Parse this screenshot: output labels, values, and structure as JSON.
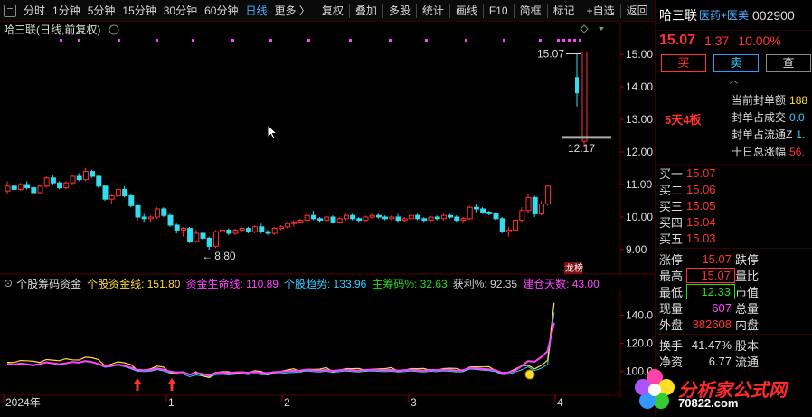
{
  "toolbar": {
    "left_items": [
      "分时",
      "1分钟",
      "5分钟",
      "15分钟",
      "30分钟",
      "60分钟",
      "日线",
      "更多 〉"
    ],
    "active_item": "日线",
    "right_items": [
      "复权",
      "叠加",
      "多股",
      "统计",
      "画线",
      "F10",
      "简框",
      "标记",
      "+自选",
      "返回"
    ]
  },
  "main_chart": {
    "title": "哈三联(日线,前复权)",
    "price_axis": [
      "15.00",
      "14.00",
      "13.00",
      "12.00",
      "11.00",
      "10.00",
      "9.00"
    ],
    "high_label": "15.07",
    "low_label": "12.17",
    "min_label": "8.80",
    "lhb_badge": "龙榜"
  },
  "indicator": {
    "name": "个股筹码资金",
    "lines": [
      {
        "label": "个股资金线: 151.80",
        "color": "#ffdd33"
      },
      {
        "label": "资金生命线: 110.89",
        "color": "#ff44ff"
      },
      {
        "label": "个股趋势: 133.96",
        "color": "#33ccff"
      },
      {
        "label": "主筹码%: 32.63",
        "color": "#22dd22"
      },
      {
        "label": "获利%: 92.35",
        "color": "#cccccc"
      },
      {
        "label": "建仓天数: 43.00",
        "color": "#ff44ff"
      }
    ],
    "axis": [
      "140.0",
      "120.0",
      "100.0"
    ]
  },
  "time_axis": {
    "labels": [
      "2024年",
      "1",
      "2",
      "3",
      "4"
    ]
  },
  "right_panel": {
    "name": "哈三联",
    "tags": "医药+医美",
    "code": "002900",
    "price": "15.07",
    "change": "1.37",
    "change_pct": "10.00%",
    "buttons": [
      "买",
      "卖",
      "查"
    ],
    "board_text": "5天4板",
    "seal": [
      {
        "label": "当前封单额",
        "value": "188"
      },
      {
        "label": "封单占成交",
        "value": "0.0"
      },
      {
        "label": "封单占流通Z",
        "value": "1."
      },
      {
        "label": "十日总涨幅",
        "value": "56."
      }
    ],
    "bids": [
      {
        "label": "买一",
        "value": "15.07"
      },
      {
        "label": "买二",
        "value": "15.06"
      },
      {
        "label": "买三",
        "value": "15.05"
      },
      {
        "label": "买四",
        "value": "15.04"
      },
      {
        "label": "买五",
        "value": "15.03"
      }
    ],
    "stats": [
      {
        "label": "涨停",
        "value": "15.07",
        "label2": "跌停"
      },
      {
        "label": "最高",
        "value": "15.07",
        "label2": "量比"
      },
      {
        "label": "最低",
        "value": "12.33",
        "label2": "市值"
      },
      {
        "label": "现量",
        "value": "607",
        "label2": "总量"
      },
      {
        "label": "外盘",
        "value": "382608",
        "label2": "内盘"
      }
    ],
    "stats2": [
      {
        "label": "换手",
        "value": "41.47%",
        "label2": "股本"
      },
      {
        "label": "净资",
        "value": "6.77",
        "label2": "流通"
      }
    ]
  },
  "watermark": {
    "text": "分析家公式网",
    "url": "70822.com"
  },
  "colors": {
    "up": "#ff3333",
    "down": "#33ddee",
    "bg": "#000000",
    "ma_yellow": "#ffdd33",
    "ma_magenta": "#ff44ff"
  },
  "chart_data": {
    "type": "candlestick",
    "ylim": [
      8.5,
      15.5
    ],
    "candles": [
      [
        10.8,
        11.1,
        10.7,
        10.95
      ],
      [
        10.95,
        11.0,
        10.8,
        10.85
      ],
      [
        10.85,
        11.05,
        10.8,
        11.0
      ],
      [
        11.0,
        11.1,
        10.85,
        10.9
      ],
      [
        10.9,
        10.95,
        10.7,
        10.75
      ],
      [
        10.75,
        11.0,
        10.7,
        10.95
      ],
      [
        10.95,
        11.25,
        10.9,
        11.2
      ],
      [
        11.2,
        11.3,
        11.0,
        11.05
      ],
      [
        11.05,
        11.1,
        10.85,
        10.9
      ],
      [
        10.9,
        11.1,
        10.85,
        11.05
      ],
      [
        11.05,
        11.3,
        11.0,
        11.25
      ],
      [
        11.25,
        11.35,
        11.1,
        11.15
      ],
      [
        11.15,
        11.5,
        11.1,
        11.4
      ],
      [
        11.4,
        11.45,
        11.2,
        11.25
      ],
      [
        11.25,
        11.3,
        10.9,
        10.95
      ],
      [
        10.95,
        11.0,
        10.5,
        10.55
      ],
      [
        10.55,
        10.7,
        10.4,
        10.65
      ],
      [
        10.65,
        10.9,
        10.6,
        10.85
      ],
      [
        10.85,
        10.95,
        10.6,
        10.65
      ],
      [
        10.65,
        10.7,
        10.3,
        10.35
      ],
      [
        10.35,
        10.4,
        9.9,
        10.0
      ],
      [
        10.0,
        10.1,
        9.85,
        9.95
      ],
      [
        9.95,
        10.05,
        9.85,
        10.0
      ],
      [
        10.0,
        10.3,
        9.95,
        10.25
      ],
      [
        10.25,
        10.3,
        10.0,
        10.05
      ],
      [
        10.05,
        10.1,
        9.7,
        9.75
      ],
      [
        9.75,
        9.8,
        9.5,
        9.6
      ],
      [
        9.6,
        9.7,
        9.4,
        9.65
      ],
      [
        9.65,
        9.7,
        9.2,
        9.25
      ],
      [
        9.25,
        9.6,
        9.2,
        9.5
      ],
      [
        9.5,
        9.55,
        9.3,
        9.35
      ],
      [
        9.35,
        9.4,
        9.0,
        9.1
      ],
      [
        9.1,
        9.6,
        9.05,
        9.55
      ],
      [
        9.55,
        9.7,
        9.5,
        9.6
      ],
      [
        9.6,
        9.65,
        9.45,
        9.5
      ],
      [
        9.5,
        9.65,
        9.45,
        9.6
      ],
      [
        9.6,
        9.7,
        9.55,
        9.65
      ],
      [
        9.65,
        9.7,
        9.5,
        9.55
      ],
      [
        9.55,
        9.75,
        9.5,
        9.7
      ],
      [
        9.7,
        9.8,
        9.5,
        9.55
      ],
      [
        9.55,
        9.6,
        9.45,
        9.5
      ],
      [
        9.5,
        9.7,
        9.45,
        9.65
      ],
      [
        9.65,
        9.75,
        9.6,
        9.7
      ],
      [
        9.7,
        9.85,
        9.65,
        9.8
      ],
      [
        9.8,
        9.9,
        9.7,
        9.85
      ],
      [
        9.85,
        9.95,
        9.8,
        9.9
      ],
      [
        9.9,
        10.1,
        9.85,
        10.05
      ],
      [
        10.05,
        10.2,
        9.9,
        9.95
      ],
      [
        9.95,
        10.0,
        9.85,
        9.9
      ],
      [
        9.9,
        10.05,
        9.85,
        10.0
      ],
      [
        10.0,
        10.05,
        9.8,
        9.85
      ],
      [
        9.85,
        10.0,
        9.8,
        9.95
      ],
      [
        9.95,
        10.1,
        9.9,
        10.05
      ],
      [
        10.05,
        10.1,
        9.9,
        9.95
      ],
      [
        9.95,
        10.0,
        9.85,
        9.9
      ],
      [
        9.9,
        10.05,
        9.85,
        10.0
      ],
      [
        10.0,
        10.1,
        9.95,
        10.05
      ],
      [
        10.05,
        10.1,
        9.95,
        10.0
      ],
      [
        10.0,
        10.05,
        9.9,
        9.95
      ],
      [
        9.95,
        10.05,
        9.9,
        10.0
      ],
      [
        10.0,
        10.1,
        9.85,
        9.9
      ],
      [
        9.9,
        10.0,
        9.85,
        9.95
      ],
      [
        9.95,
        10.1,
        9.9,
        10.05
      ],
      [
        10.05,
        10.1,
        9.9,
        9.95
      ],
      [
        9.95,
        10.0,
        9.85,
        9.9
      ],
      [
        9.9,
        10.05,
        9.85,
        10.0
      ],
      [
        10.0,
        10.05,
        9.9,
        9.95
      ],
      [
        9.95,
        10.1,
        9.9,
        10.05
      ],
      [
        10.05,
        10.1,
        9.95,
        10.0
      ],
      [
        10.0,
        10.05,
        9.85,
        9.9
      ],
      [
        9.9,
        10.0,
        9.8,
        9.95
      ],
      [
        9.95,
        10.35,
        9.9,
        10.3
      ],
      [
        10.3,
        10.4,
        10.15,
        10.25
      ],
      [
        10.25,
        10.3,
        10.1,
        10.15
      ],
      [
        10.15,
        10.2,
        10.05,
        10.1
      ],
      [
        10.1,
        10.15,
        9.9,
        9.95
      ],
      [
        9.95,
        10.0,
        9.5,
        9.55
      ],
      [
        9.55,
        9.7,
        9.4,
        9.6
      ],
      [
        9.6,
        9.95,
        9.55,
        9.9
      ],
      [
        9.9,
        10.3,
        9.85,
        10.2
      ],
      [
        10.2,
        10.7,
        10.1,
        10.6
      ],
      [
        10.6,
        10.65,
        10.0,
        10.1
      ],
      [
        10.1,
        10.5,
        10.05,
        10.4
      ],
      [
        10.4,
        11.0,
        10.35,
        10.95
      ],
      [
        12.33,
        15.07,
        12.17,
        15.07
      ]
    ]
  }
}
